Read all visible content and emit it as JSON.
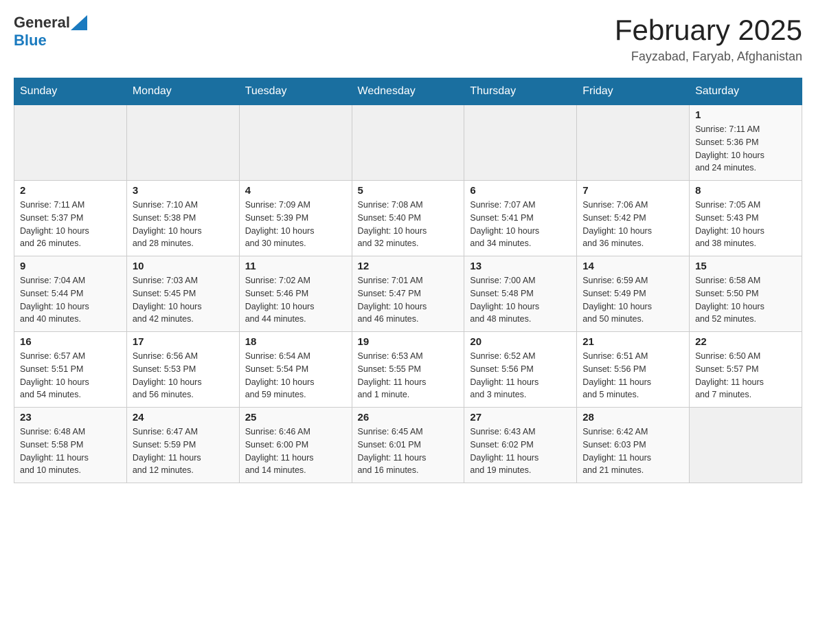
{
  "header": {
    "logo_general": "General",
    "logo_blue": "Blue",
    "month_title": "February 2025",
    "location": "Fayzabad, Faryab, Afghanistan"
  },
  "weekdays": [
    "Sunday",
    "Monday",
    "Tuesday",
    "Wednesday",
    "Thursday",
    "Friday",
    "Saturday"
  ],
  "weeks": [
    [
      {
        "date": "",
        "info": ""
      },
      {
        "date": "",
        "info": ""
      },
      {
        "date": "",
        "info": ""
      },
      {
        "date": "",
        "info": ""
      },
      {
        "date": "",
        "info": ""
      },
      {
        "date": "",
        "info": ""
      },
      {
        "date": "1",
        "info": "Sunrise: 7:11 AM\nSunset: 5:36 PM\nDaylight: 10 hours\nand 24 minutes."
      }
    ],
    [
      {
        "date": "2",
        "info": "Sunrise: 7:11 AM\nSunset: 5:37 PM\nDaylight: 10 hours\nand 26 minutes."
      },
      {
        "date": "3",
        "info": "Sunrise: 7:10 AM\nSunset: 5:38 PM\nDaylight: 10 hours\nand 28 minutes."
      },
      {
        "date": "4",
        "info": "Sunrise: 7:09 AM\nSunset: 5:39 PM\nDaylight: 10 hours\nand 30 minutes."
      },
      {
        "date": "5",
        "info": "Sunrise: 7:08 AM\nSunset: 5:40 PM\nDaylight: 10 hours\nand 32 minutes."
      },
      {
        "date": "6",
        "info": "Sunrise: 7:07 AM\nSunset: 5:41 PM\nDaylight: 10 hours\nand 34 minutes."
      },
      {
        "date": "7",
        "info": "Sunrise: 7:06 AM\nSunset: 5:42 PM\nDaylight: 10 hours\nand 36 minutes."
      },
      {
        "date": "8",
        "info": "Sunrise: 7:05 AM\nSunset: 5:43 PM\nDaylight: 10 hours\nand 38 minutes."
      }
    ],
    [
      {
        "date": "9",
        "info": "Sunrise: 7:04 AM\nSunset: 5:44 PM\nDaylight: 10 hours\nand 40 minutes."
      },
      {
        "date": "10",
        "info": "Sunrise: 7:03 AM\nSunset: 5:45 PM\nDaylight: 10 hours\nand 42 minutes."
      },
      {
        "date": "11",
        "info": "Sunrise: 7:02 AM\nSunset: 5:46 PM\nDaylight: 10 hours\nand 44 minutes."
      },
      {
        "date": "12",
        "info": "Sunrise: 7:01 AM\nSunset: 5:47 PM\nDaylight: 10 hours\nand 46 minutes."
      },
      {
        "date": "13",
        "info": "Sunrise: 7:00 AM\nSunset: 5:48 PM\nDaylight: 10 hours\nand 48 minutes."
      },
      {
        "date": "14",
        "info": "Sunrise: 6:59 AM\nSunset: 5:49 PM\nDaylight: 10 hours\nand 50 minutes."
      },
      {
        "date": "15",
        "info": "Sunrise: 6:58 AM\nSunset: 5:50 PM\nDaylight: 10 hours\nand 52 minutes."
      }
    ],
    [
      {
        "date": "16",
        "info": "Sunrise: 6:57 AM\nSunset: 5:51 PM\nDaylight: 10 hours\nand 54 minutes."
      },
      {
        "date": "17",
        "info": "Sunrise: 6:56 AM\nSunset: 5:53 PM\nDaylight: 10 hours\nand 56 minutes."
      },
      {
        "date": "18",
        "info": "Sunrise: 6:54 AM\nSunset: 5:54 PM\nDaylight: 10 hours\nand 59 minutes."
      },
      {
        "date": "19",
        "info": "Sunrise: 6:53 AM\nSunset: 5:55 PM\nDaylight: 11 hours\nand 1 minute."
      },
      {
        "date": "20",
        "info": "Sunrise: 6:52 AM\nSunset: 5:56 PM\nDaylight: 11 hours\nand 3 minutes."
      },
      {
        "date": "21",
        "info": "Sunrise: 6:51 AM\nSunset: 5:56 PM\nDaylight: 11 hours\nand 5 minutes."
      },
      {
        "date": "22",
        "info": "Sunrise: 6:50 AM\nSunset: 5:57 PM\nDaylight: 11 hours\nand 7 minutes."
      }
    ],
    [
      {
        "date": "23",
        "info": "Sunrise: 6:48 AM\nSunset: 5:58 PM\nDaylight: 11 hours\nand 10 minutes."
      },
      {
        "date": "24",
        "info": "Sunrise: 6:47 AM\nSunset: 5:59 PM\nDaylight: 11 hours\nand 12 minutes."
      },
      {
        "date": "25",
        "info": "Sunrise: 6:46 AM\nSunset: 6:00 PM\nDaylight: 11 hours\nand 14 minutes."
      },
      {
        "date": "26",
        "info": "Sunrise: 6:45 AM\nSunset: 6:01 PM\nDaylight: 11 hours\nand 16 minutes."
      },
      {
        "date": "27",
        "info": "Sunrise: 6:43 AM\nSunset: 6:02 PM\nDaylight: 11 hours\nand 19 minutes."
      },
      {
        "date": "28",
        "info": "Sunrise: 6:42 AM\nSunset: 6:03 PM\nDaylight: 11 hours\nand 21 minutes."
      },
      {
        "date": "",
        "info": ""
      }
    ]
  ]
}
